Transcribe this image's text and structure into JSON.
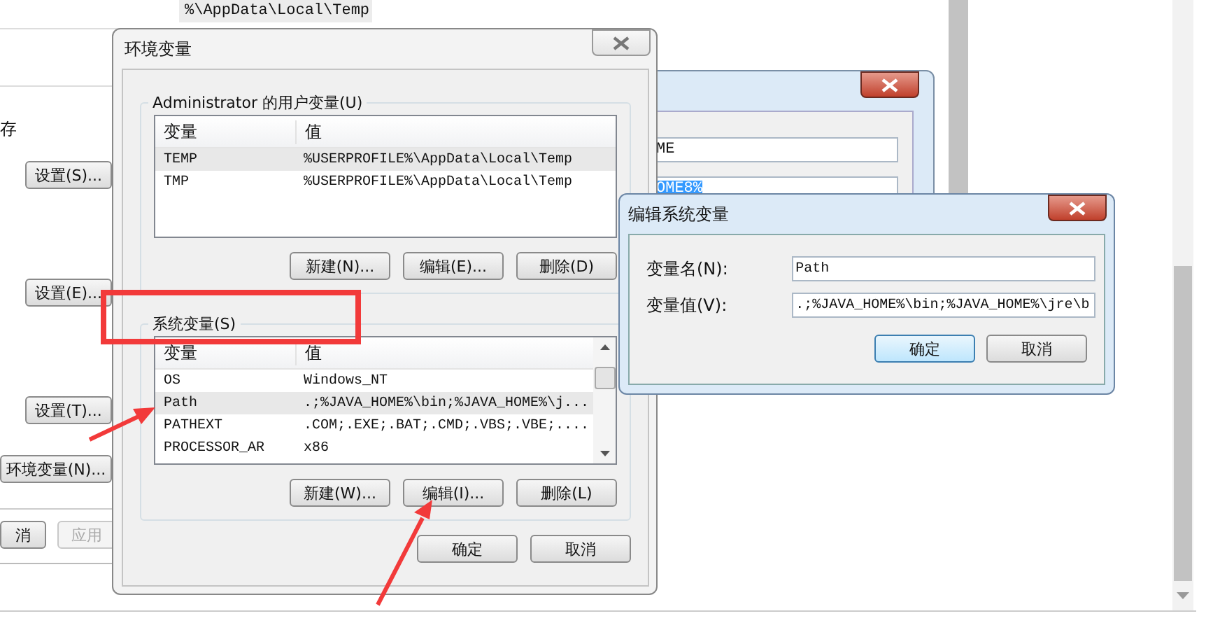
{
  "background_window": {
    "list_fragment": {
      "text": "%\\AppData\\Local\\Temp",
      "selected": true
    },
    "label_fragment": "存",
    "buttons": [
      {
        "label": "设置(S)..."
      },
      {
        "label": "设置(E)..."
      },
      {
        "label": "设置(T)..."
      },
      {
        "label": "环境变量(N)..."
      }
    ],
    "footer_buttons": [
      {
        "label": "消",
        "disabled": false
      },
      {
        "label": "应用",
        "disabled": true
      }
    ]
  },
  "hidden_dialog": {
    "fields": [
      {
        "value": "ME",
        "selected": false
      },
      {
        "value": "OME8%",
        "selected": true
      }
    ]
  },
  "env_dialog": {
    "title": "环境变量",
    "groups": [
      {
        "title": "Administrator 的用户变量(U)",
        "columns": [
          "变量",
          "值"
        ],
        "scrollbar": false,
        "rows": [
          {
            "name": "TEMP",
            "value": "%USERPROFILE%\\AppData\\Local\\Temp",
            "selected": true
          },
          {
            "name": "TMP",
            "value": "%USERPROFILE%\\AppData\\Local\\Temp",
            "selected": false
          }
        ],
        "buttons": [
          "新建(N)...",
          "编辑(E)...",
          "删除(D)"
        ]
      },
      {
        "title": "系统变量(S)",
        "columns": [
          "变量",
          "值"
        ],
        "scrollbar": true,
        "rows": [
          {
            "name": "OS",
            "value": "Windows_NT",
            "selected": false
          },
          {
            "name": "Path",
            "value": ".;%JAVA_HOME%\\bin;%JAVA_HOME%\\j...",
            "selected": true
          },
          {
            "name": "PATHEXT",
            "value": ".COM;.EXE;.BAT;.CMD;.VBS;.VBE;....",
            "selected": false
          },
          {
            "name": "PROCESSOR_AR",
            "value": "x86",
            "selected": false
          }
        ],
        "buttons": [
          "新建(W)...",
          "编辑(I)...",
          "删除(L)"
        ]
      }
    ],
    "buttons": [
      "确定",
      "取消"
    ]
  },
  "edit_dialog": {
    "title": "编辑系统变量",
    "fields": [
      {
        "label": "变量名(N):",
        "value": "Path"
      },
      {
        "label": "变量值(V):",
        "value": ".;%JAVA_HOME%\\bin;%JAVA_HOME%\\jre\\b"
      }
    ],
    "buttons": [
      {
        "label": "确定",
        "default": true
      },
      {
        "label": "取消",
        "default": false
      }
    ]
  }
}
